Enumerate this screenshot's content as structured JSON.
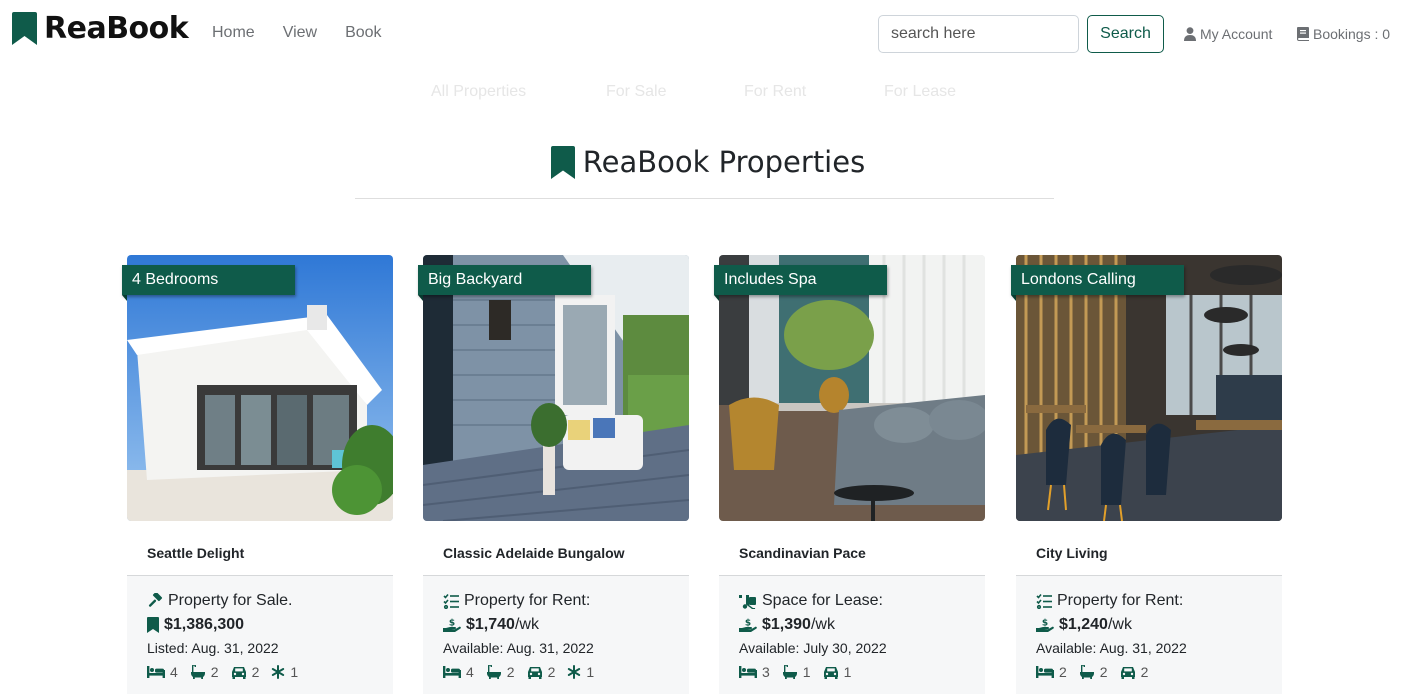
{
  "brand": {
    "name": "ReaBook"
  },
  "nav": {
    "home": "Home",
    "view": "View",
    "book": "Book"
  },
  "search": {
    "placeholder": "search here",
    "button": "Search"
  },
  "account": {
    "my_account": "My Account",
    "bookings": "Bookings : 0"
  },
  "filters": [
    "All Properties",
    "For Sale",
    "For Rent",
    "For Lease"
  ],
  "page": {
    "title": "ReaBook Properties"
  },
  "colors": {
    "brand": "#0f5b4a",
    "ribbon": "#0f5b4a",
    "footer_bg": "#f6f7f8"
  },
  "cards": [
    {
      "ribbon": "4 Bedrooms",
      "name": "Seattle Delight",
      "type_icon": "gavel-icon",
      "type_label": "Property for Sale.",
      "price_icon": "bookmark-icon",
      "price": "$1,386,300",
      "price_unit": "",
      "date": "Listed: Aug. 31, 2022",
      "features": {
        "beds": "4",
        "baths": "2",
        "cars": "2",
        "ac": "1"
      }
    },
    {
      "ribbon": "Big Backyard",
      "name": "Classic Adelaide Bungalow",
      "type_icon": "list-check-icon",
      "type_label": "Property for Rent:",
      "price_icon": "hand-holding-dollar-icon",
      "price": "$1,740",
      "price_unit": " /wk",
      "date": "Available: Aug. 31, 2022",
      "features": {
        "beds": "4",
        "baths": "2",
        "cars": "2",
        "ac": "1"
      }
    },
    {
      "ribbon": "Includes Spa",
      "name": "Scandinavian Pace",
      "type_icon": "truck-ramp-box-icon",
      "type_label": "Space for Lease:",
      "price_icon": "hand-holding-dollar-icon",
      "price": "$1,390",
      "price_unit": " /wk",
      "date": "Available: July 30, 2022",
      "features": {
        "beds": "3",
        "baths": "1",
        "cars": "1"
      }
    },
    {
      "ribbon": "Londons Calling",
      "name": "City Living",
      "type_icon": "list-check-icon",
      "type_label": "Property for Rent:",
      "price_icon": "hand-holding-dollar-icon",
      "price": "$1,240",
      "price_unit": " /wk",
      "date": "Available: Aug. 31, 2022",
      "features": {
        "beds": "2",
        "baths": "2",
        "cars": "2"
      }
    }
  ]
}
